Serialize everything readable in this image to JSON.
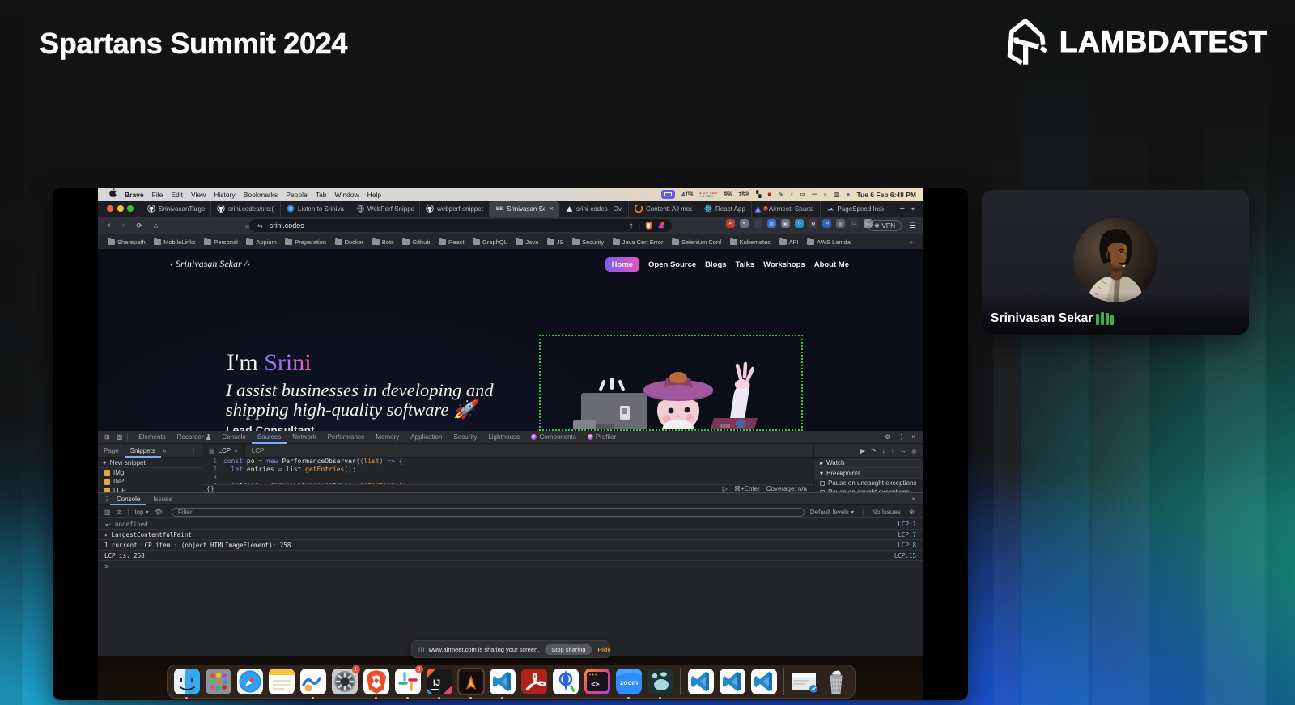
{
  "stage": {
    "title": "Spartans Summit 2024",
    "brand": "LAMBDATEST"
  },
  "menubar": {
    "items": [
      "Brave",
      "File",
      "Edit",
      "View",
      "History",
      "Bookmarks",
      "People",
      "Tab",
      "Window",
      "Help"
    ],
    "status": {
      "cpu_label": "CPU",
      "cpu": "41%",
      "net_up": "100 KB/s",
      "net_down": "3 KB/s",
      "gpu_label": "GPU",
      "gpu": "9%",
      "ram_label": "RAM",
      "ram": "75%",
      "clock": "Tue 6 Feb  6:48 PM"
    }
  },
  "tabs": [
    {
      "fav": "gh",
      "label": "SrinivasanTarget/w"
    },
    {
      "fav": "gh",
      "label": "srini.codes/src:(scr"
    },
    {
      "fav": "sp",
      "label": "Listen to Srinivasa"
    },
    {
      "fav": "wp",
      "label": "WebPerf Snippets"
    },
    {
      "fav": "gh",
      "label": "webperf-snippets"
    },
    {
      "fav": "ss",
      "label": "Srinivasan Sek",
      "active": true,
      "close": "×"
    },
    {
      "fav": "vc",
      "label": "srini-codes - Ove"
    },
    {
      "fav": "cc",
      "label": "Content: All media"
    },
    {
      "fav": "re",
      "label": "React App"
    },
    {
      "fav": "am",
      "label": "Airmeet: Sparta"
    },
    {
      "fav": "ps",
      "label": "PageSpeed Insig"
    }
  ],
  "toolbar": {
    "url": "srini.codes",
    "vpn": "VPN",
    "extensions": [
      {
        "bg": "#b93c30",
        "ch": "A"
      },
      {
        "bg": "#6c7180",
        "ch": "♥"
      },
      {
        "bg": "#3a3d44",
        "ch": "◔"
      },
      {
        "bg": "#3d6bd8",
        "ch": "▤"
      },
      {
        "bg": "#6a6f79",
        "ch": "▣"
      },
      {
        "bg": "#2e8fb8",
        "ch": "G"
      },
      {
        "bg": "#3a3d44",
        "ch": "✿"
      },
      {
        "bg": "#2f5fc2",
        "ch": "M"
      },
      {
        "bg": "#5a5e68",
        "ch": "◍"
      },
      {
        "bg": "#33363d",
        "ch": "□"
      },
      {
        "bg": "#8a8f99",
        "ch": "▭"
      }
    ]
  },
  "bookmarks": [
    "Sharepath",
    "MobileLinks",
    "Personal",
    "Appium",
    "Preparation",
    "Docker",
    "Bots",
    "Github",
    "React",
    "GraphQL",
    "Java",
    "JS",
    "Security",
    "Java Cert Error",
    "Selenium Conf",
    "Kubernetes",
    "API",
    "AWS Lamda"
  ],
  "site": {
    "logo": "‹ Srinivasan Sekar /›",
    "nav": [
      {
        "label": "Home",
        "active": true
      },
      {
        "label": "Open Source"
      },
      {
        "label": "Blogs"
      },
      {
        "label": "Talks"
      },
      {
        "label": "Workshops"
      },
      {
        "label": "About Me"
      }
    ],
    "hero_prefix": "I'm",
    "hero_name": "Srini",
    "tagline1": "I assist businesses in developing and",
    "tagline2": "shipping high-quality software 🚀",
    "subtitle": "Lead Consultant"
  },
  "devtools": {
    "tabs": [
      {
        "label": "Elements"
      },
      {
        "label": "Recorder",
        "flask": true
      },
      {
        "label": "Console"
      },
      {
        "label": "Sources",
        "active": true
      },
      {
        "label": "Network"
      },
      {
        "label": "Performance"
      },
      {
        "label": "Memory"
      },
      {
        "label": "Application"
      },
      {
        "label": "Security"
      },
      {
        "label": "Lighthouse"
      },
      {
        "label": "Components",
        "atom": true
      },
      {
        "label": "Profiler",
        "atom": true
      }
    ],
    "sidebar": {
      "page": "Page",
      "snippets": "Snippets",
      "new_snippet": "New snippet",
      "items": [
        "IMg",
        "INP",
        "LCP"
      ]
    },
    "editor": {
      "tab1": "LCP",
      "tab2": "LCP",
      "status_key": "⌘+Enter",
      "status_cov": "Coverage: n/a",
      "lines": [
        {
          "n": "1",
          "toks": [
            [
              "kw",
              "const "
            ],
            [
              "v",
              "po "
            ],
            [
              "p",
              "= "
            ],
            [
              "kw",
              "new "
            ],
            [
              "v",
              "PerformanceObserver"
            ],
            [
              "p",
              "(("
            ],
            [
              "ar",
              "list"
            ],
            [
              "p",
              ") "
            ],
            [
              "kw",
              "=> "
            ],
            [
              "p",
              "{"
            ]
          ]
        },
        {
          "n": "2",
          "toks": [
            [
              "p",
              "  "
            ],
            [
              "kw",
              "let "
            ],
            [
              "v",
              "entries "
            ],
            [
              "p",
              "= "
            ],
            [
              "v",
              "list"
            ],
            [
              "p",
              "."
            ],
            [
              "fn",
              "getEntries"
            ],
            [
              "p",
              "();"
            ]
          ]
        },
        {
          "n": "3",
          "toks": []
        },
        {
          "n": "4",
          "toks": [
            [
              "p",
              "  "
            ],
            [
              "v",
              "entries "
            ],
            [
              "p",
              "= "
            ],
            [
              "fn",
              "dedupeEntries"
            ],
            [
              "p",
              "("
            ],
            [
              "v",
              "entries"
            ],
            [
              "p",
              ", "
            ],
            [
              "st",
              "\"startTime\""
            ],
            [
              "p",
              ");"
            ]
          ]
        }
      ]
    },
    "debug": {
      "watch": "Watch",
      "breakpoints": "Breakpoints",
      "cb1": "Pause on uncaught exceptions",
      "cb2": "Pause on caught exceptions"
    },
    "console": {
      "tab1": "Console",
      "tab2": "Issues",
      "top": "top",
      "filter_placeholder": "Filter",
      "levels": "Default levels",
      "no_issues": "No Issues",
      "rows": [
        {
          "prefix": "◂·",
          "text": "undefined",
          "dim": true,
          "link": "LCP:1"
        },
        {
          "prefix": "▸",
          "text": "LargestContentfulPaint",
          "link": "LCP:7"
        },
        {
          "prefix": "",
          "text": "1 current LCP item : (object HTMLImageElement): 258",
          "link": "LCP:8"
        },
        {
          "prefix": "",
          "text": "LCP is: 258",
          "link": "LCP:15",
          "underline": true
        }
      ],
      "prompt": ">"
    }
  },
  "sharebar": {
    "text": "www.airmeet.com is sharing your screen.",
    "stop": "Stop sharing",
    "hide": "Hide"
  },
  "dock": [
    {
      "name": "finder",
      "icon": "#di-finder",
      "dot": true
    },
    {
      "name": "launchpad",
      "icon": "#di-launchpad"
    },
    {
      "name": "safari",
      "icon": "#di-safari"
    },
    {
      "name": "notes",
      "icon": "#di-notes"
    },
    {
      "name": "freeform",
      "icon": "#di-wave",
      "dot": true
    },
    {
      "name": "settings",
      "icon": "#di-settings",
      "badge": "1"
    },
    {
      "name": "brave",
      "icon": "#di-brave",
      "dot": true
    },
    {
      "name": "slack",
      "icon": "#di-slack",
      "badge": "3",
      "dot": true
    },
    {
      "name": "intellij",
      "icon": "#di-intellij",
      "dot": true
    },
    {
      "name": "astro-terminal",
      "icon": "#di-aterm",
      "dot": true
    },
    {
      "name": "vscode",
      "icon": "#di-vscode",
      "dot": true
    },
    {
      "name": "acrobat",
      "icon": "#di-acrobat"
    },
    {
      "name": "xcode",
      "icon": "#di-xcode"
    },
    {
      "name": "dev-terminal",
      "icon": "#di-devterm"
    },
    {
      "name": "zoom",
      "icon": "#di-zoom",
      "dot": true
    },
    {
      "name": "paws",
      "icon": "#di-paws",
      "dot": true
    },
    {
      "sep": true
    },
    {
      "name": "vscode-win1",
      "icon": "#di-vscode"
    },
    {
      "name": "vscode-win2",
      "icon": "#di-vscode"
    },
    {
      "name": "vscode-win3",
      "icon": "#di-vscode"
    },
    {
      "sep": true
    },
    {
      "name": "minimized-window",
      "icon": "#di-window"
    },
    {
      "name": "trash",
      "icon": "#di-trash"
    }
  ],
  "webcam": {
    "name": "Srinivasan Sekar",
    "bars": [
      14,
      16,
      15,
      12
    ]
  }
}
